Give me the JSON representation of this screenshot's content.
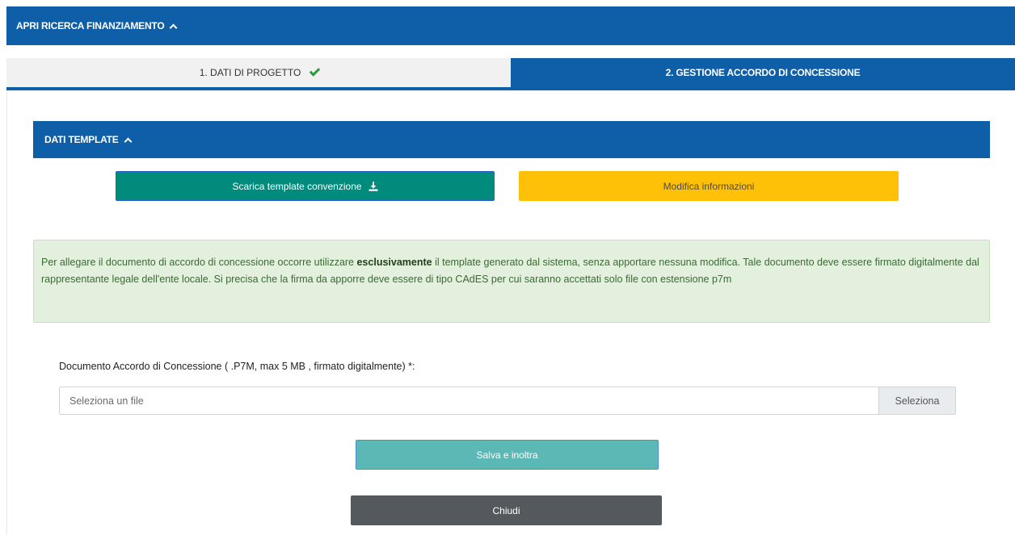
{
  "top_bar": {
    "label": "APRI RICERCA FINANZIAMENTO"
  },
  "tabs": [
    {
      "label": "1. DATI DI PROGETTO",
      "completed": true
    },
    {
      "label": "2. GESTIONE ACCORDO DI CONCESSIONE",
      "active": true
    }
  ],
  "section": {
    "title": "DATI TEMPLATE"
  },
  "buttons": {
    "download_template": "Scarica template convenzione",
    "modify_info": "Modifica informazioni",
    "save": "Salva e inoltra",
    "close": "Chiudi"
  },
  "alert": {
    "text_before": "Per allegare il documento di accordo di concessione occorre utilizzare ",
    "bold": "esclusivamente",
    "text_after": " il template generato dal sistema, senza apportare nessuna modifica. Tale documento deve essere firmato digitalmente dal rappresentante legale dell'ente locale. Si precisa che la firma da apporre deve essere di tipo CAdES per cui saranno accettati solo file con estensione p7m"
  },
  "file_upload": {
    "label": "Documento Accordo di Concessione ( .P7M, max 5 MB , firmato digitalmente) *:",
    "placeholder": "Seleziona un file",
    "button": "Seleziona"
  },
  "colors": {
    "primary": "#0f5fa8",
    "success": "#2c9a3f",
    "download_btn": "#008b7c",
    "modify_btn": "#ffc107",
    "save_btn": "#5bb8b5",
    "close_btn": "#54595e",
    "alert_bg": "#e3f0dd"
  },
  "icons": [
    "chevron-up-icon",
    "checkmark-icon",
    "download-icon"
  ]
}
